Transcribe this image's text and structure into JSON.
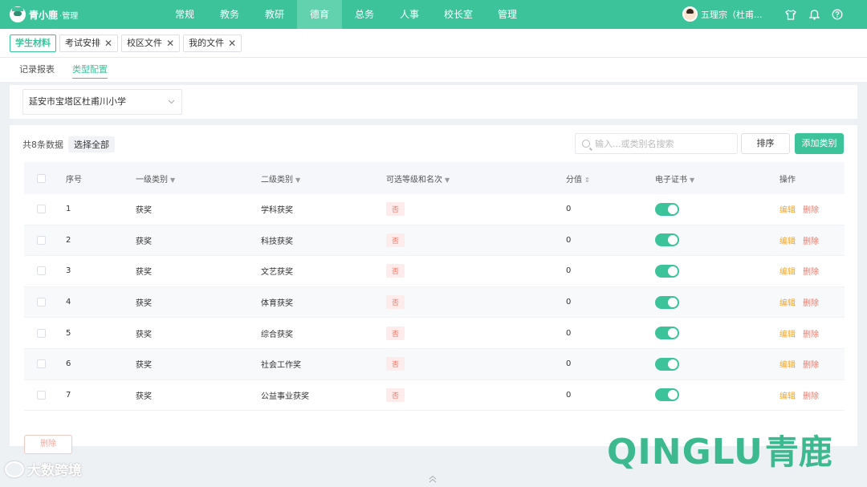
{
  "brand": {
    "name": "青小鹿",
    "suffix": "·管理"
  },
  "nav": {
    "items": [
      {
        "label": "常规",
        "active": false
      },
      {
        "label": "教务",
        "active": false
      },
      {
        "label": "教研",
        "active": false
      },
      {
        "label": "德育",
        "active": true
      },
      {
        "label": "总务",
        "active": false
      },
      {
        "label": "人事",
        "active": false
      },
      {
        "label": "校长室",
        "active": false
      },
      {
        "label": "管理",
        "active": false
      }
    ]
  },
  "user": {
    "name": "五理宗（杜甫..."
  },
  "tabs": [
    {
      "label": "学生材料",
      "active": true
    },
    {
      "label": "考试安排",
      "closable": true
    },
    {
      "label": "校区文件",
      "closable": true
    },
    {
      "label": "我的文件",
      "closable": true
    }
  ],
  "subtabs": [
    {
      "label": "记录报表",
      "active": false
    },
    {
      "label": "类型配置",
      "active": true
    }
  ],
  "school_select": {
    "value": "延安市宝塔区杜甫川小学"
  },
  "toolbar": {
    "count_text": "共8条数据",
    "select_all": "选择全部",
    "search_placeholder": "输入...或类别名搜索",
    "sort_label": "排序",
    "add_label": "添加类别"
  },
  "table": {
    "headers": {
      "index": "序号",
      "cat1": "一级类别",
      "cat2": "二级类别",
      "level": "可选等级和名次",
      "score": "分值",
      "cert": "电子证书",
      "ops": "操作"
    },
    "rows": [
      {
        "index": "1",
        "cat1": "获奖",
        "cat2": "学科获奖",
        "level": "否",
        "score": "0",
        "cert_on": true
      },
      {
        "index": "2",
        "cat1": "获奖",
        "cat2": "科技获奖",
        "level": "否",
        "score": "0",
        "cert_on": true
      },
      {
        "index": "3",
        "cat1": "获奖",
        "cat2": "文艺获奖",
        "level": "否",
        "score": "0",
        "cert_on": true
      },
      {
        "index": "4",
        "cat1": "获奖",
        "cat2": "体育获奖",
        "level": "否",
        "score": "0",
        "cert_on": true
      },
      {
        "index": "5",
        "cat1": "获奖",
        "cat2": "综合获奖",
        "level": "否",
        "score": "0",
        "cert_on": true
      },
      {
        "index": "6",
        "cat1": "获奖",
        "cat2": "社会工作奖",
        "level": "否",
        "score": "0",
        "cert_on": true
      },
      {
        "index": "7",
        "cat1": "获奖",
        "cat2": "公益事业获奖",
        "level": "否",
        "score": "0",
        "cert_on": true
      }
    ],
    "edit_label": "编辑",
    "delete_label": "删除"
  },
  "footer": {
    "delete_label": "删除"
  },
  "watermarks": {
    "left": "大数跨境",
    "right_latin": "QINGLU",
    "right_cjk": "青鹿"
  },
  "colors": {
    "brand_green": "#3cc39a",
    "danger": "#f07a6b",
    "warning": "#f5a623"
  }
}
